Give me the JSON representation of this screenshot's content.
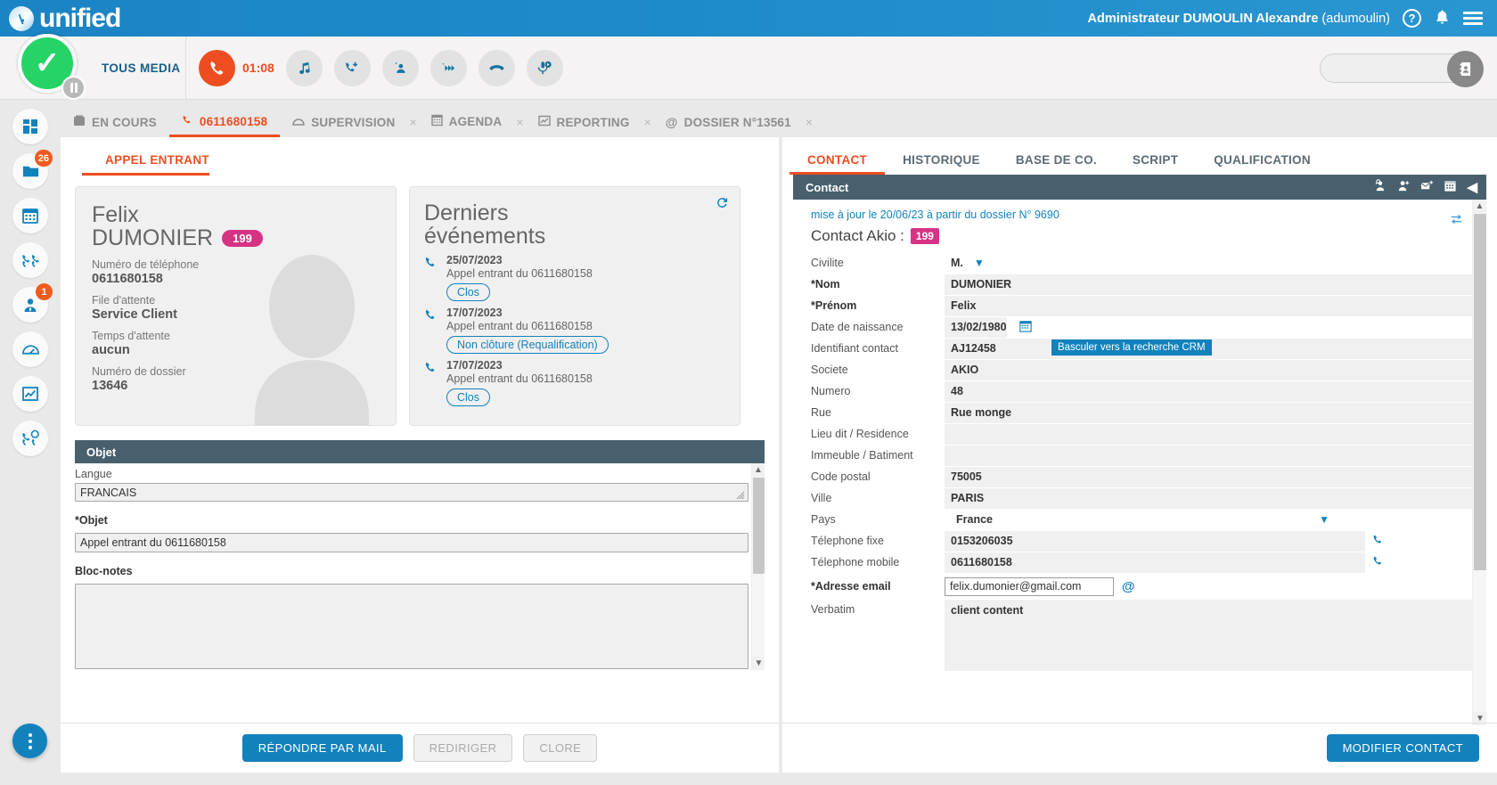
{
  "header": {
    "brand": "unified",
    "brand_mark": "akio-logo-icon",
    "user": "Administrateur DUMOULIN Alexandre",
    "user_login": "(adumoulin)",
    "help_icon": "?",
    "bell_icon": "notification-bell-icon",
    "menu_icon": "hamburger-menu-icon",
    "accent_blue": "#1b84c4"
  },
  "mediabar": {
    "status_label": "TOUS MEDIA",
    "status_icon": "available-check-icon",
    "pause_icon": "pause-icon",
    "call_timer": "01:08",
    "call_icon": "phone-active-icon",
    "tools": [
      {
        "name": "hold-music-icon",
        "glyph": "♫"
      },
      {
        "name": "transfer-call-icon",
        "glyph": "⤴"
      },
      {
        "name": "consult-agent-icon",
        "glyph": "↰"
      },
      {
        "name": "forward-call-icon",
        "glyph": "»"
      },
      {
        "name": "hangup-icon",
        "glyph": "☎"
      },
      {
        "name": "record-call-icon",
        "glyph": "◉"
      }
    ],
    "search_value": "",
    "search_placeholder": "",
    "search_icon": "contact-directory-icon"
  },
  "sidebar": {
    "items": [
      {
        "name": "dashboard-icon",
        "badge": ""
      },
      {
        "name": "folder-icon",
        "badge": "26"
      },
      {
        "name": "calendar-icon",
        "badge": ""
      },
      {
        "name": "call-flow-icon",
        "badge": ""
      },
      {
        "name": "agent-icon",
        "badge": "1"
      },
      {
        "name": "supervision-gauge-icon",
        "badge": ""
      },
      {
        "name": "reporting-chart-icon",
        "badge": ""
      },
      {
        "name": "call-settings-icon",
        "badge": ""
      }
    ],
    "fab_name": "more-options-fab"
  },
  "tabs": [
    {
      "label": "EN COURS",
      "icon": "inbox-icon",
      "active": false,
      "closable": false
    },
    {
      "label": "0611680158",
      "icon": "phone-icon",
      "active": true,
      "closable": false
    },
    {
      "label": "SUPERVISION",
      "icon": "supervision-icon",
      "active": false,
      "closable": true
    },
    {
      "label": "AGENDA",
      "icon": "agenda-icon",
      "active": false,
      "closable": true
    },
    {
      "label": "REPORTING",
      "icon": "chart-icon",
      "active": false,
      "closable": true
    },
    {
      "label": "DOSSIER N°13561",
      "icon": "at-icon",
      "active": false,
      "closable": true
    }
  ],
  "left": {
    "section_title": "APPEL ENTRANT",
    "customer": {
      "first_name": "Felix",
      "last_name": "DUMONIER",
      "badge": "199",
      "fields": [
        {
          "label": "Numéro de téléphone",
          "value": "0611680158"
        },
        {
          "label": "File d'attente",
          "value": "Service Client"
        },
        {
          "label": "Temps d'attente",
          "value": "aucun"
        },
        {
          "label": "Numéro de dossier",
          "value": "13646"
        }
      ]
    },
    "events": {
      "title_line1": "Derniers",
      "title_line2": "événements",
      "refresh_icon": "refresh-icon",
      "items": [
        {
          "date": "25/07/2023",
          "desc": "Appel entrant du 0611680158",
          "chip": "Clos"
        },
        {
          "date": "17/07/2023",
          "desc": "Appel entrant du 0611680158",
          "chip": "Non clôture (Requalification)"
        },
        {
          "date": "17/07/2023",
          "desc": "Appel entrant du 0611680158",
          "chip": "Clos"
        }
      ]
    },
    "objet": {
      "header": "Objet",
      "langue_label": "Langue",
      "langue_value": "FRANCAIS",
      "objet_label": "*Objet",
      "objet_value": "Appel entrant du 0611680158",
      "blocnotes_label": "Bloc-notes",
      "blocnotes_value": ""
    },
    "buttons": [
      {
        "label": "RÉPONDRE PAR MAIL",
        "style": "primary",
        "name": "reply-by-mail-button"
      },
      {
        "label": "REDIRIGER",
        "style": "disabled",
        "name": "redirect-button"
      },
      {
        "label": "CLORE",
        "style": "disabled",
        "name": "close-button"
      }
    ]
  },
  "right": {
    "tabs": [
      {
        "label": "CONTACT",
        "active": true
      },
      {
        "label": "HISTORIQUE",
        "active": false
      },
      {
        "label": "BASE DE CO.",
        "active": false
      },
      {
        "label": "SCRIPT",
        "active": false
      },
      {
        "label": "QUALIFICATION",
        "active": false
      }
    ],
    "panel_header": "Contact",
    "header_icons": [
      {
        "name": "search-contact-icon",
        "glyph": "⚲"
      },
      {
        "name": "add-contact-icon",
        "glyph": "⚲"
      },
      {
        "name": "attach-contact-icon",
        "glyph": "✉"
      },
      {
        "name": "calendar-icon",
        "glyph": "Ὄ5"
      },
      {
        "name": "collapse-panel-icon",
        "glyph": "◀"
      }
    ],
    "tooltip": "Basculer vers la recherche CRM",
    "sync_icon": "sync-crm-icon",
    "update_line": "mise à jour le 20/06/23 à partir du dossier N° 9690",
    "akio_label": "Contact Akio :",
    "akio_badge": "199",
    "fields": [
      {
        "label": "Civilite",
        "value": "M.",
        "type": "select"
      },
      {
        "label": "*Nom",
        "value": "DUMONIER",
        "type": "text",
        "required": true
      },
      {
        "label": "*Prénom",
        "value": "Felix",
        "type": "text",
        "required": true
      },
      {
        "label": "Date de naissance",
        "value": "13/02/1980",
        "type": "date"
      },
      {
        "label": "Identifiant contact",
        "value": "AJ12458",
        "type": "text"
      },
      {
        "label": "Societe",
        "value": "AKIO",
        "type": "text"
      },
      {
        "label": "Numero",
        "value": "48",
        "type": "text"
      },
      {
        "label": "Rue",
        "value": "Rue monge",
        "type": "text"
      },
      {
        "label": "Lieu dit / Residence",
        "value": "",
        "type": "text"
      },
      {
        "label": "Immeuble / Batiment",
        "value": "",
        "type": "text"
      },
      {
        "label": "Code postal",
        "value": "75005",
        "type": "text"
      },
      {
        "label": "Ville",
        "value": "PARIS",
        "type": "text"
      },
      {
        "label": "Pays",
        "value": "France",
        "type": "select"
      },
      {
        "label": "Télephone fixe",
        "value": "0153206035",
        "type": "phone"
      },
      {
        "label": "Télephone mobile",
        "value": "0611680158",
        "type": "phone"
      },
      {
        "label": "*Adresse email",
        "value": "felix.dumonier@gmail.com",
        "type": "email",
        "required": true
      },
      {
        "label": "Verbatim",
        "value": "client content",
        "type": "textarea"
      }
    ],
    "modify_button": "MODIFIER CONTACT"
  }
}
